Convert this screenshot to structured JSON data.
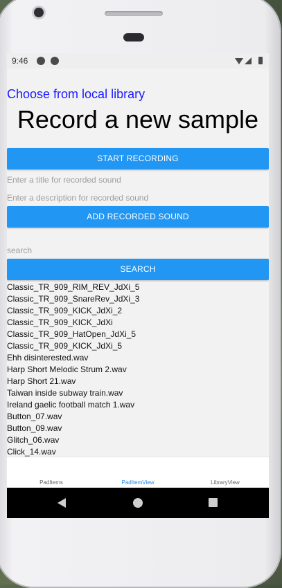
{
  "status": {
    "time": "9:46"
  },
  "header": {
    "library_link": "Choose from local library",
    "title": "Record a new sample"
  },
  "record": {
    "start_label": "START RECORDING",
    "title_placeholder": "Enter a title for recorded sound",
    "description_placeholder": "Enter a description for recorded sound",
    "add_label": "ADD RECORDED SOUND"
  },
  "search": {
    "placeholder": "search",
    "button_label": "SEARCH"
  },
  "results": [
    "Classic_TR_909_RIM_REV_JdXi_5",
    "Classic_TR_909_SnareRev_JdXi_3",
    "Classic_TR_909_KICK_JdXi_2",
    "Classic_TR_909_KICK_JdXi",
    "Classic_TR_909_HatOpen_JdXi_5",
    "Classic_TR_909_KICK_JdXi_5",
    "Ehh disinterested.wav",
    "Harp Short Melodic Strum 2.wav",
    "Harp Short 21.wav",
    "Taiwan  inside subway train.wav",
    "Ireland gaelic football match 1.wav",
    "Button_07.wav",
    "Button_09.wav",
    "Glitch_06.wav",
    "Click_14.wav"
  ],
  "tabs": [
    {
      "label": "PadItems",
      "active": false
    },
    {
      "label": "PadItemView",
      "active": true
    },
    {
      "label": "LibraryView",
      "active": false
    }
  ]
}
